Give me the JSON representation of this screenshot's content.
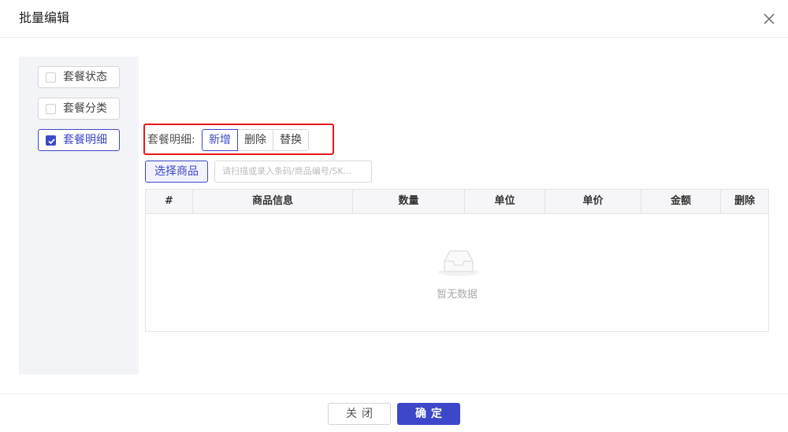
{
  "dialog": {
    "title": "批量编辑"
  },
  "sidebar": {
    "options": [
      {
        "label": "套餐状态",
        "checked": false
      },
      {
        "label": "套餐分类",
        "checked": false
      },
      {
        "label": "套餐明细",
        "checked": true
      }
    ]
  },
  "detail": {
    "label": "套餐明细:",
    "modes": [
      "新增",
      "删除",
      "替换"
    ],
    "active_mode": "新增"
  },
  "toolbar": {
    "select_button": "选择商品",
    "scan_placeholder": "请扫描或录入条码/商品编号/SK..."
  },
  "table": {
    "columns": [
      "#",
      "商品信息",
      "数量",
      "单位",
      "单价",
      "金额",
      "删除"
    ],
    "rows": [],
    "empty_text": "暂无数据"
  },
  "footer": {
    "close_label": "关闭",
    "confirm_label": "确定"
  },
  "colors": {
    "accent": "#3d47c9",
    "highlight_border": "#e8161d"
  },
  "icons": {
    "close": "close-icon",
    "checkbox_checked": "checkmark-icon",
    "empty": "empty-inbox-icon"
  }
}
